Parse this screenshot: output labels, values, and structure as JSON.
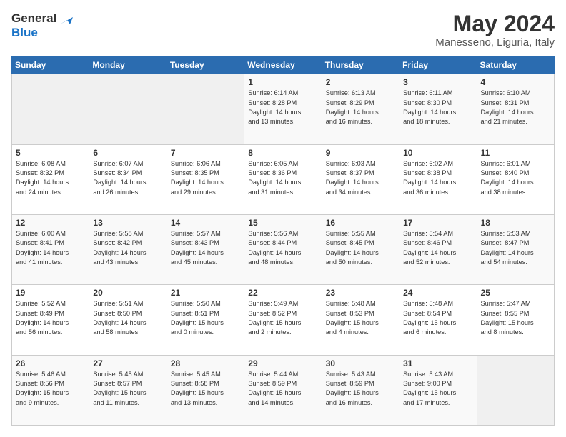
{
  "header": {
    "logo_line1": "General",
    "logo_line2": "Blue",
    "main_title": "May 2024",
    "subtitle": "Manesseno, Liguria, Italy"
  },
  "calendar": {
    "weekdays": [
      "Sunday",
      "Monday",
      "Tuesday",
      "Wednesday",
      "Thursday",
      "Friday",
      "Saturday"
    ],
    "weeks": [
      [
        {
          "day": "",
          "info": ""
        },
        {
          "day": "",
          "info": ""
        },
        {
          "day": "",
          "info": ""
        },
        {
          "day": "1",
          "info": "Sunrise: 6:14 AM\nSunset: 8:28 PM\nDaylight: 14 hours\nand 13 minutes."
        },
        {
          "day": "2",
          "info": "Sunrise: 6:13 AM\nSunset: 8:29 PM\nDaylight: 14 hours\nand 16 minutes."
        },
        {
          "day": "3",
          "info": "Sunrise: 6:11 AM\nSunset: 8:30 PM\nDaylight: 14 hours\nand 18 minutes."
        },
        {
          "day": "4",
          "info": "Sunrise: 6:10 AM\nSunset: 8:31 PM\nDaylight: 14 hours\nand 21 minutes."
        }
      ],
      [
        {
          "day": "5",
          "info": "Sunrise: 6:08 AM\nSunset: 8:32 PM\nDaylight: 14 hours\nand 24 minutes."
        },
        {
          "day": "6",
          "info": "Sunrise: 6:07 AM\nSunset: 8:34 PM\nDaylight: 14 hours\nand 26 minutes."
        },
        {
          "day": "7",
          "info": "Sunrise: 6:06 AM\nSunset: 8:35 PM\nDaylight: 14 hours\nand 29 minutes."
        },
        {
          "day": "8",
          "info": "Sunrise: 6:05 AM\nSunset: 8:36 PM\nDaylight: 14 hours\nand 31 minutes."
        },
        {
          "day": "9",
          "info": "Sunrise: 6:03 AM\nSunset: 8:37 PM\nDaylight: 14 hours\nand 34 minutes."
        },
        {
          "day": "10",
          "info": "Sunrise: 6:02 AM\nSunset: 8:38 PM\nDaylight: 14 hours\nand 36 minutes."
        },
        {
          "day": "11",
          "info": "Sunrise: 6:01 AM\nSunset: 8:40 PM\nDaylight: 14 hours\nand 38 minutes."
        }
      ],
      [
        {
          "day": "12",
          "info": "Sunrise: 6:00 AM\nSunset: 8:41 PM\nDaylight: 14 hours\nand 41 minutes."
        },
        {
          "day": "13",
          "info": "Sunrise: 5:58 AM\nSunset: 8:42 PM\nDaylight: 14 hours\nand 43 minutes."
        },
        {
          "day": "14",
          "info": "Sunrise: 5:57 AM\nSunset: 8:43 PM\nDaylight: 14 hours\nand 45 minutes."
        },
        {
          "day": "15",
          "info": "Sunrise: 5:56 AM\nSunset: 8:44 PM\nDaylight: 14 hours\nand 48 minutes."
        },
        {
          "day": "16",
          "info": "Sunrise: 5:55 AM\nSunset: 8:45 PM\nDaylight: 14 hours\nand 50 minutes."
        },
        {
          "day": "17",
          "info": "Sunrise: 5:54 AM\nSunset: 8:46 PM\nDaylight: 14 hours\nand 52 minutes."
        },
        {
          "day": "18",
          "info": "Sunrise: 5:53 AM\nSunset: 8:47 PM\nDaylight: 14 hours\nand 54 minutes."
        }
      ],
      [
        {
          "day": "19",
          "info": "Sunrise: 5:52 AM\nSunset: 8:49 PM\nDaylight: 14 hours\nand 56 minutes."
        },
        {
          "day": "20",
          "info": "Sunrise: 5:51 AM\nSunset: 8:50 PM\nDaylight: 14 hours\nand 58 minutes."
        },
        {
          "day": "21",
          "info": "Sunrise: 5:50 AM\nSunset: 8:51 PM\nDaylight: 15 hours\nand 0 minutes."
        },
        {
          "day": "22",
          "info": "Sunrise: 5:49 AM\nSunset: 8:52 PM\nDaylight: 15 hours\nand 2 minutes."
        },
        {
          "day": "23",
          "info": "Sunrise: 5:48 AM\nSunset: 8:53 PM\nDaylight: 15 hours\nand 4 minutes."
        },
        {
          "day": "24",
          "info": "Sunrise: 5:48 AM\nSunset: 8:54 PM\nDaylight: 15 hours\nand 6 minutes."
        },
        {
          "day": "25",
          "info": "Sunrise: 5:47 AM\nSunset: 8:55 PM\nDaylight: 15 hours\nand 8 minutes."
        }
      ],
      [
        {
          "day": "26",
          "info": "Sunrise: 5:46 AM\nSunset: 8:56 PM\nDaylight: 15 hours\nand 9 minutes."
        },
        {
          "day": "27",
          "info": "Sunrise: 5:45 AM\nSunset: 8:57 PM\nDaylight: 15 hours\nand 11 minutes."
        },
        {
          "day": "28",
          "info": "Sunrise: 5:45 AM\nSunset: 8:58 PM\nDaylight: 15 hours\nand 13 minutes."
        },
        {
          "day": "29",
          "info": "Sunrise: 5:44 AM\nSunset: 8:59 PM\nDaylight: 15 hours\nand 14 minutes."
        },
        {
          "day": "30",
          "info": "Sunrise: 5:43 AM\nSunset: 8:59 PM\nDaylight: 15 hours\nand 16 minutes."
        },
        {
          "day": "31",
          "info": "Sunrise: 5:43 AM\nSunset: 9:00 PM\nDaylight: 15 hours\nand 17 minutes."
        },
        {
          "day": "",
          "info": ""
        }
      ]
    ]
  }
}
